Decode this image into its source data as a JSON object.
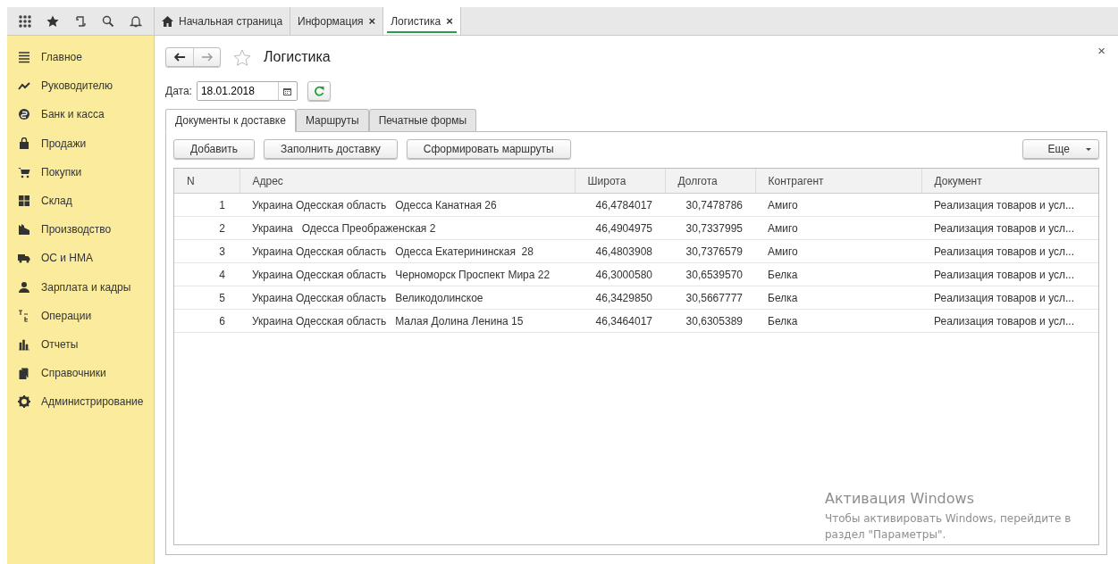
{
  "top_tabs": [
    {
      "label": "Начальная страница",
      "kind": "home",
      "closable": false,
      "selected": false
    },
    {
      "label": "Информация",
      "kind": "page",
      "closable": true,
      "selected": false
    },
    {
      "label": "Логистика",
      "kind": "page",
      "closable": true,
      "selected": true
    }
  ],
  "close_glyph": "×",
  "sidebar": {
    "items": [
      {
        "label": "Главное"
      },
      {
        "label": "Руководителю"
      },
      {
        "label": "Банк и касса"
      },
      {
        "label": "Продажи"
      },
      {
        "label": "Покупки"
      },
      {
        "label": "Склад"
      },
      {
        "label": "Производство"
      },
      {
        "label": "ОС и НМА"
      },
      {
        "label": "Зарплата и кадры"
      },
      {
        "label": "Операции"
      },
      {
        "label": "Отчеты"
      },
      {
        "label": "Справочники"
      },
      {
        "label": "Администрирование"
      }
    ]
  },
  "form": {
    "title": "Логистика",
    "date_label": "Дата:",
    "date_value": "18.01.2018",
    "tabs": [
      {
        "label": "Документы к доставке",
        "selected": true
      },
      {
        "label": "Маршруты",
        "selected": false
      },
      {
        "label": "Печатные формы",
        "selected": false
      }
    ],
    "buttons": [
      "Добавить",
      "Заполнить доставку",
      "Сформировать маршруты"
    ],
    "more_button": "Еще",
    "table": {
      "columns": [
        "N",
        "Адрес",
        "Широта",
        "Долгота",
        "Контрагент",
        "Документ"
      ],
      "rows": [
        [
          "1",
          "Украина Одесская область   Одесса Канатная 26",
          "46,4784017",
          "30,7478786",
          "Амиго",
          "Реализация товаров и усл..."
        ],
        [
          "2",
          "Украина   Одесса Преображенская 2",
          "46,4904975",
          "30,7337995",
          "Амиго",
          "Реализация товаров и усл..."
        ],
        [
          "3",
          "Украина Одесская область   Одесса Екатерининская  28",
          "46,4803908",
          "30,7376579",
          "Амиго",
          "Реализация товаров и усл..."
        ],
        [
          "4",
          "Украина Одесская область   Черноморск Проспект Мира 22",
          "46,3000580",
          "30,6539570",
          "Белка",
          "Реализация товаров и усл..."
        ],
        [
          "5",
          "Украина Одесская область   Великодолинское",
          "46,3429850",
          "30,5667777",
          "Белка",
          "Реализация товаров и усл..."
        ],
        [
          "6",
          "Украина Одесская область   Малая Долина Ленина 15",
          "46,3464017",
          "30,6305389",
          "Белка",
          "Реализация товаров и усл..."
        ]
      ]
    }
  },
  "activation_notice": {
    "title": "Активация Windows",
    "text": "Чтобы активировать Windows, перейдите в раздел \"Параметры\"."
  }
}
